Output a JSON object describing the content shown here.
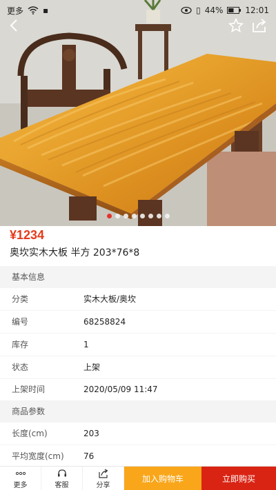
{
  "status_bar": {
    "left_label": "更多",
    "battery": "44%",
    "time": "12:01"
  },
  "gallery": {
    "dot_count": 8,
    "active_index": 0
  },
  "product": {
    "price": "¥1234",
    "title": "奥坎实木大板 半方 203*76*8"
  },
  "basic_info": {
    "header": "基本信息",
    "rows": [
      {
        "label": "分类",
        "value": "实木大板/奥坎"
      },
      {
        "label": "编号",
        "value": "68258824"
      },
      {
        "label": "库存",
        "value": "1"
      },
      {
        "label": "状态",
        "value": "上架"
      },
      {
        "label": "上架时间",
        "value": "2020/05/09 11:47"
      }
    ]
  },
  "params": {
    "header": "商品参数",
    "rows": [
      {
        "label": "长度(cm)",
        "value": "203"
      },
      {
        "label": "平均宽度(cm)",
        "value": "76"
      }
    ]
  },
  "bottom_bar": {
    "more": "更多",
    "service": "客服",
    "share": "分享",
    "add_to_cart": "加入购物车",
    "buy_now": "立即购买"
  },
  "colors": {
    "price": "#e53a1c",
    "cart_button": "#f9a61a",
    "buy_button": "#d92414",
    "active_dot": "#e5231b"
  }
}
